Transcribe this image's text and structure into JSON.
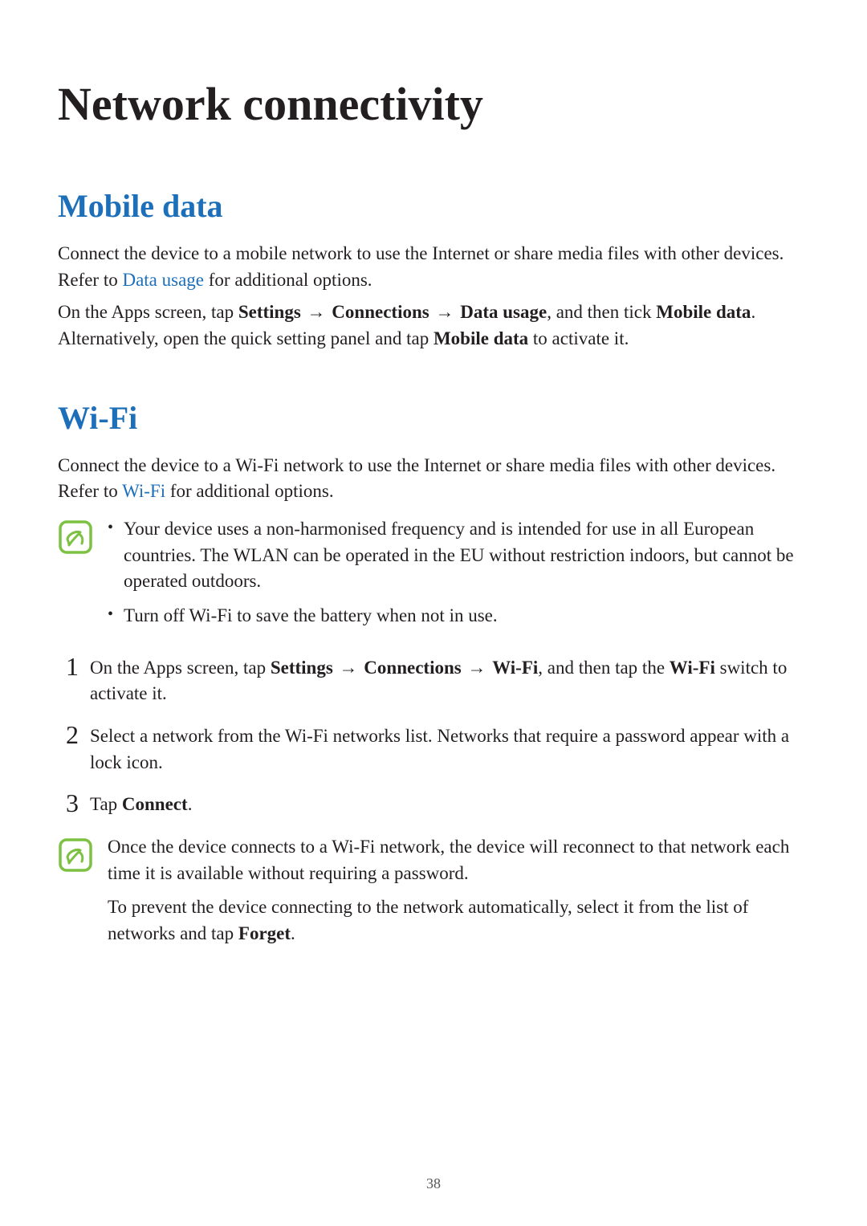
{
  "pageNumber": "38",
  "title": "Network connectivity",
  "arrow": "→",
  "mobileData": {
    "heading": "Mobile data",
    "p1_pre": "Connect the device to a mobile network to use the Internet or share media files with other devices. Refer to ",
    "p1_link": "Data usage",
    "p1_post": " for additional options.",
    "p2_a": "On the Apps screen, tap ",
    "p2_settings": "Settings",
    "p2_connections": "Connections",
    "p2_datausage": "Data usage",
    "p2_b": ", and then tick ",
    "p2_mobiledata": "Mobile data",
    "p2_c": ". Alternatively, open the quick setting panel and tap ",
    "p2_mobiledata2": "Mobile data",
    "p2_d": " to activate it."
  },
  "wifi": {
    "heading": "Wi-Fi",
    "p1_pre": "Connect the device to a Wi-Fi network to use the Internet or share media files with other devices. Refer to ",
    "p1_link": "Wi-Fi",
    "p1_post": " for additional options.",
    "note_bullet1": "Your device uses a non-harmonised frequency and is intended for use in all European countries. The WLAN can be operated in the EU without restriction indoors, but cannot be operated outdoors.",
    "note_bullet2": "Turn off Wi-Fi to save the battery when not in use.",
    "step1_a": "On the Apps screen, tap ",
    "step1_settings": "Settings",
    "step1_connections": "Connections",
    "step1_wifi": "Wi-Fi",
    "step1_b": ", and then tap the ",
    "step1_wifi2": "Wi-Fi",
    "step1_c": " switch to activate it.",
    "step2": "Select a network from the Wi-Fi networks list. Networks that require a password appear with a lock icon.",
    "step3_a": "Tap ",
    "step3_connect": "Connect",
    "step3_b": ".",
    "note2_p1": "Once the device connects to a Wi-Fi network, the device will reconnect to that network each time it is available without requiring a password.",
    "note2_p2_a": "To prevent the device connecting to the network automatically, select it from the list of networks and tap ",
    "note2_forget": "Forget",
    "note2_p2_b": "."
  }
}
